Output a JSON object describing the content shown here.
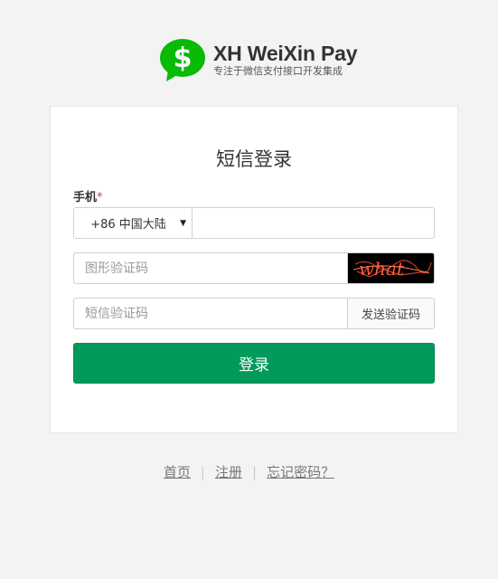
{
  "brand": {
    "title": "XH WeiXin Pay",
    "subtitle": "专注于微信支付接口开发集成",
    "icon": "dollar-chat-icon",
    "accent": "#09bb07"
  },
  "form": {
    "title": "短信登录",
    "phone_label": "手机",
    "required_mark": "*",
    "country_code": "+86 中国大陆",
    "phone_placeholder": "",
    "captcha_placeholder": "图形验证码",
    "captcha_text": "what",
    "sms_placeholder": "短信验证码",
    "send_code_label": "发送验证码",
    "submit_label": "登录",
    "submit_color": "#009a5a"
  },
  "footer": {
    "links": [
      "首页",
      "注册",
      "忘记密码？"
    ],
    "separator": "|"
  }
}
